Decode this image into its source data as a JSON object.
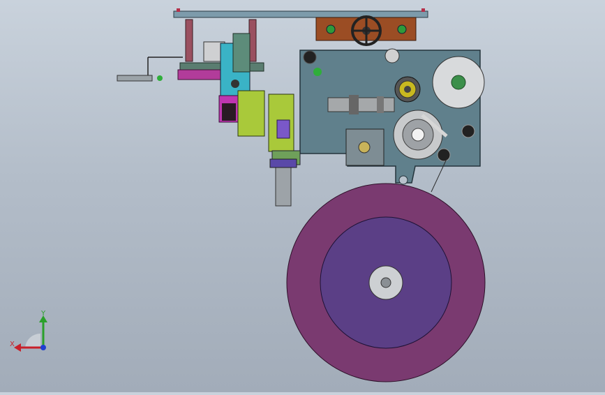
{
  "viewport": {
    "background_top": "#c9d2dc",
    "background_bottom": "#a2acb9"
  },
  "model": {
    "colors": {
      "frame_plate": "#5f7a86",
      "top_rail": "#6f8fa0",
      "big_reel_outer": "#7a3a70",
      "big_reel_inner": "#5b3f86",
      "bracket_orange": "#9a4a22",
      "lime_parts": "#a8c83a",
      "magenta_parts": "#c03ab0",
      "cyan_parts": "#39b5c8"
    }
  },
  "triad": {
    "x_label": "X",
    "y_label": "Y",
    "x_color": "#c8202a",
    "y_color": "#2aa02a",
    "z_color": "#1f3fd0"
  }
}
